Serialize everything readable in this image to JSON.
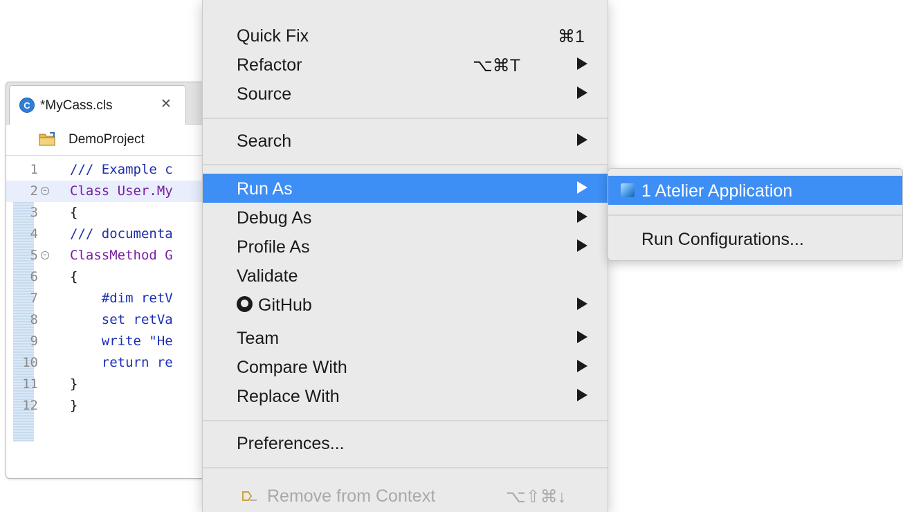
{
  "editor": {
    "tab": {
      "icon": "class-file-icon",
      "icon_letter": "C",
      "label": "*MyCass.cls",
      "close_glyph": "✕"
    },
    "breadcrumb": {
      "icon": "project-folder-icon",
      "label": "DemoProject"
    },
    "lines": [
      {
        "num": "1",
        "fold": "",
        "text": "/// Example c",
        "style": "comment"
      },
      {
        "num": "2",
        "fold": "⊖",
        "text": "Class User.My",
        "style": "keyword"
      },
      {
        "num": "3",
        "fold": "",
        "text": "{",
        "style": "plain"
      },
      {
        "num": "4",
        "fold": "",
        "text": "/// documenta",
        "style": "comment"
      },
      {
        "num": "5",
        "fold": "⊖",
        "text": "ClassMethod G",
        "style": "keyword"
      },
      {
        "num": "6",
        "fold": "",
        "text": "{",
        "style": "plain"
      },
      {
        "num": "7",
        "fold": "",
        "text": "    #dim retV",
        "style": "cmd"
      },
      {
        "num": "8",
        "fold": "",
        "text": "    set retVa",
        "style": "cmd"
      },
      {
        "num": "9",
        "fold": "",
        "text": "    write \"He",
        "style": "cmd"
      },
      {
        "num": "10",
        "fold": "",
        "text": "    return re",
        "style": "cmd"
      },
      {
        "num": "11",
        "fold": "",
        "text": "}",
        "style": "plain"
      },
      {
        "num": "12",
        "fold": "",
        "text": "}",
        "style": "plain"
      }
    ]
  },
  "menu": {
    "items": [
      {
        "label": "Quick Fix",
        "shortcut": "⌘1",
        "submenu": false
      },
      {
        "label": "Refactor",
        "shortcut": "⌥⌘T",
        "submenu": true
      },
      {
        "label": "Source",
        "shortcut": "",
        "submenu": true
      },
      {
        "label": "Search",
        "shortcut": "",
        "submenu": true
      },
      {
        "label": "Run As",
        "shortcut": "",
        "submenu": true,
        "active": true
      },
      {
        "label": "Debug As",
        "shortcut": "",
        "submenu": true
      },
      {
        "label": "Profile As",
        "shortcut": "",
        "submenu": true
      },
      {
        "label": "Validate",
        "shortcut": "",
        "submenu": false
      },
      {
        "label": "GitHub",
        "shortcut": "",
        "submenu": true,
        "icon": "github-icon"
      },
      {
        "label": "Team",
        "shortcut": "",
        "submenu": true
      },
      {
        "label": "Compare With",
        "shortcut": "",
        "submenu": true
      },
      {
        "label": "Replace With",
        "shortcut": "",
        "submenu": true
      },
      {
        "label": "Preferences...",
        "shortcut": "",
        "submenu": false
      },
      {
        "label": "Remove from Context",
        "shortcut": "⌥⇧⌘↓",
        "submenu": false,
        "disabled": true,
        "icon": "remove-context-icon"
      }
    ]
  },
  "submenu": {
    "items": [
      {
        "label": "1 Atelier Application",
        "icon": "atelier-cube-icon",
        "active": true
      },
      {
        "label": "Run Configurations...",
        "active": false
      }
    ]
  },
  "colors": {
    "accent": "#3d8ef5",
    "menu_bg": "#eaeaea",
    "comment": "#1f2fa8",
    "keyword": "#7b1fa2"
  }
}
